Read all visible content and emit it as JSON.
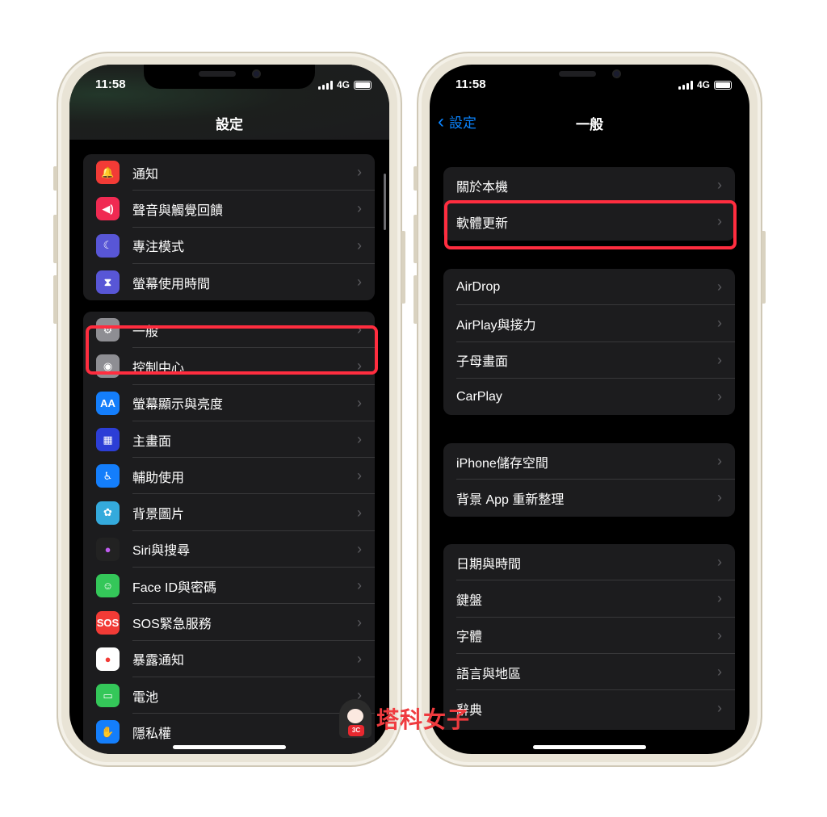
{
  "left": {
    "time": "11:58",
    "network": "4G",
    "title": "設定",
    "group1": [
      {
        "label": "通知",
        "icon": "bell-icon",
        "color": "#f23b36"
      },
      {
        "label": "聲音與觸覺回饋",
        "icon": "speaker-icon",
        "color": "#f02a52"
      },
      {
        "label": "專注模式",
        "icon": "moon-icon",
        "color": "#5856d6"
      },
      {
        "label": "螢幕使用時間",
        "icon": "hourglass-icon",
        "color": "#5856d6"
      }
    ],
    "group2": [
      {
        "label": "一般",
        "icon": "gear-icon",
        "color": "#8e8e93"
      },
      {
        "label": "控制中心",
        "icon": "toggles-icon",
        "color": "#8e8e93"
      },
      {
        "label": "螢幕顯示與亮度",
        "icon": "text-size-icon",
        "color": "#147efb",
        "glyph": "AA"
      },
      {
        "label": "主畫面",
        "icon": "home-grid-icon",
        "color": "#2c3ed6"
      },
      {
        "label": "輔助使用",
        "icon": "accessibility-icon",
        "color": "#147efb"
      },
      {
        "label": "背景圖片",
        "icon": "flower-icon",
        "color": "#34aadc"
      },
      {
        "label": "Siri與搜尋",
        "icon": "siri-icon",
        "color": "#222"
      },
      {
        "label": "Face ID與密碼",
        "icon": "face-id-icon",
        "color": "#34c759"
      },
      {
        "label": "SOS緊急服務",
        "icon": "sos-icon",
        "color": "#f23b36",
        "glyph": "SOS"
      },
      {
        "label": "暴露通知",
        "icon": "exposure-icon",
        "color": "#ffffff"
      },
      {
        "label": "電池",
        "icon": "battery-icon",
        "color": "#34c759"
      },
      {
        "label": "隱私權",
        "icon": "hand-icon",
        "color": "#147efb"
      }
    ]
  },
  "right": {
    "time": "11:58",
    "network": "4G",
    "back_label": "設定",
    "title": "一般",
    "group1": [
      "關於本機",
      "軟體更新"
    ],
    "group2": [
      "AirDrop",
      "AirPlay與接力",
      "子母畫面",
      "CarPlay"
    ],
    "group3": [
      "iPhone儲存空間",
      "背景 App 重新整理"
    ],
    "group4": [
      "日期與時間",
      "鍵盤",
      "字體",
      "語言與地區",
      "辭典"
    ]
  },
  "highlight_color": "#ff2d3f",
  "watermark": {
    "text": "塔科女子",
    "badge": "3C"
  }
}
